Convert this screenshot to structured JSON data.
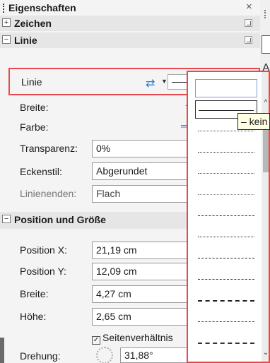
{
  "panel": {
    "title": "Eigenschaften",
    "close_glyph": "×"
  },
  "sections": {
    "zeichen": {
      "label": "Zeichen",
      "expand_glyph": "+"
    },
    "linie": {
      "label": "Linie",
      "expand_glyph": "−"
    },
    "position": {
      "label": "Position und Größe",
      "expand_glyph": "−"
    }
  },
  "linie": {
    "row_label": "Linie",
    "breite_label": "Breite:",
    "farbe_label": "Farbe:",
    "transparenz_label": "Transparenz:",
    "transparenz_value": "0%",
    "eckenstil_label": "Eckenstil:",
    "eckenstil_value": "Abgerundet",
    "linienenden_label": "Linienenden:",
    "linienenden_value": "Flach"
  },
  "position": {
    "pos_x_label": "Position X:",
    "pos_x_value": "21,19 cm",
    "pos_y_label": "Position Y:",
    "pos_y_value": "12,09 cm",
    "breite_label": "Breite:",
    "breite_value": "4,27 cm",
    "hoehe_label": "Höhe:",
    "hoehe_value": "2,65 cm",
    "ratio_label": "Seitenverhältnis",
    "ratio_checked": true,
    "drehung_label": "Drehung:",
    "drehung_value": "31,88°"
  },
  "line_styles_popup": {
    "tooltip": "– kein –",
    "items": [
      "none",
      "solid",
      "fine-dotted",
      "dotted",
      "dotted-wide",
      "dotted-sparse",
      "dot-dash-fine",
      "dashed-fine",
      "dashed-short",
      "dashed",
      "dashed-long",
      "dashed-wide",
      "dashed-xl"
    ]
  },
  "icons": {
    "swap": "swap-arrows-icon",
    "dropdown": "chevron-down-icon"
  }
}
